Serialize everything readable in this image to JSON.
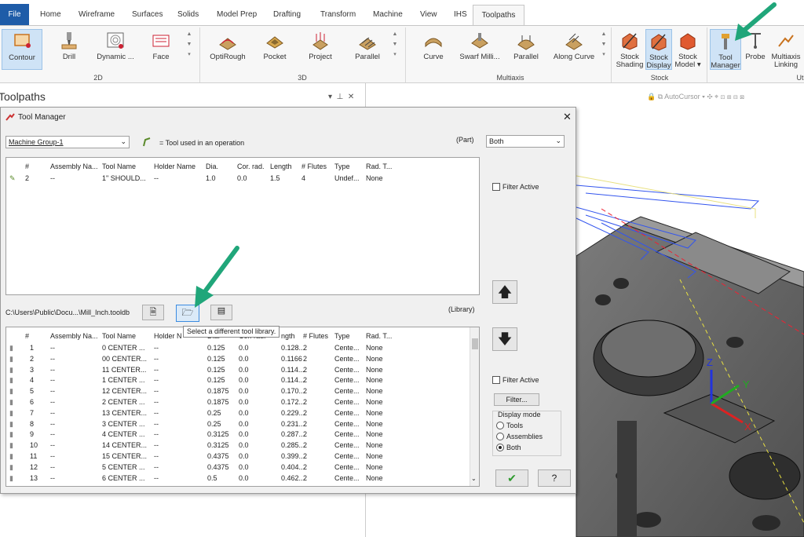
{
  "ribbon": {
    "tabs": [
      "File",
      "Home",
      "Wireframe",
      "Surfaces",
      "Solids",
      "Model Prep",
      "Drafting",
      "Transform",
      "Machine",
      "View",
      "IHS",
      "Toolpaths"
    ],
    "groups": {
      "g2d": "2D",
      "g3d": "3D",
      "multiaxis": "Multiaxis",
      "stock": "Stock",
      "util": "Ut"
    },
    "buttons": {
      "contour": "Contour",
      "drill": "Drill",
      "dynamic": "Dynamic ...",
      "face": "Face",
      "optirough": "OptiRough",
      "pocket": "Pocket",
      "project": "Project",
      "parallel3d": "Parallel",
      "curve": "Curve",
      "swarf": "Swarf Milli...",
      "parallel_ma": "Parallel",
      "along_curve": "Along Curve",
      "stock_shading_1": "Stock",
      "stock_shading_2": "Shading",
      "stock_display_1": "Stock",
      "stock_display_2": "Display",
      "stock_model_1": "Stock",
      "stock_model_2": "Model ▾",
      "tool_manager_1": "Tool",
      "tool_manager_2": "Manager",
      "probe": "Probe",
      "multiaxis_linking_1": "Multiaxis",
      "multiaxis_linking_2": "Linking"
    }
  },
  "toolpaths_pane": {
    "title": "Toolpaths",
    "pin": "⊥ ×"
  },
  "viewport": {
    "autocursor": "AutoCursor"
  },
  "dialog": {
    "title": "Tool Manager",
    "group_select": "Machine Group-1",
    "used_legend": "= Tool used in an operation",
    "part_label": "(Part)",
    "filter_mode": "Both",
    "filter_active_top": "Filter Active",
    "filter_active_bottom": "Filter Active",
    "filter_button": "Filter...",
    "display_mode": "Display mode",
    "radio_tools": "Tools",
    "radio_assemblies": "Assemblies",
    "radio_both": "Both",
    "library_path": "C:\\Users\\Public\\Docu...\\Mill_Inch.tooldb",
    "library_label": "(Library)",
    "tooltip": "Select a different tool library.",
    "columns": [
      "#",
      "Assembly Na...",
      "Tool Name",
      "Holder Name",
      "Dia.",
      "Cor. rad.",
      "Length",
      "# Flutes",
      "Type",
      "Rad. T..."
    ],
    "lib_columns": [
      "#",
      "Assembly Na...",
      "Tool Name",
      "Holder N",
      "Dia.",
      "Cor. rad.",
      "ngth",
      "# Flutes",
      "Type",
      "Rad. T..."
    ],
    "part_rows": [
      [
        "2",
        "--",
        "1\" SHOULD...",
        "--",
        "1.0",
        "0.0",
        "1.5",
        "4",
        "Undef...",
        "None"
      ]
    ],
    "lib_rows": [
      [
        "1",
        "--",
        "0 CENTER ...",
        "--",
        "0.125",
        "0.0",
        "0.128...",
        "2",
        "Cente...",
        "None"
      ],
      [
        "2",
        "--",
        "00 CENTER...",
        "--",
        "0.125",
        "0.0",
        "0.1166",
        "2",
        "Cente...",
        "None"
      ],
      [
        "3",
        "--",
        "11 CENTER...",
        "--",
        "0.125",
        "0.0",
        "0.114...",
        "2",
        "Cente...",
        "None"
      ],
      [
        "4",
        "--",
        "1 CENTER ...",
        "--",
        "0.125",
        "0.0",
        "0.114...",
        "2",
        "Cente...",
        "None"
      ],
      [
        "5",
        "--",
        "12 CENTER...",
        "--",
        "0.1875",
        "0.0",
        "0.170...",
        "2",
        "Cente...",
        "None"
      ],
      [
        "6",
        "--",
        "2 CENTER ...",
        "--",
        "0.1875",
        "0.0",
        "0.172...",
        "2",
        "Cente...",
        "None"
      ],
      [
        "7",
        "--",
        "13 CENTER...",
        "--",
        "0.25",
        "0.0",
        "0.229...",
        "2",
        "Cente...",
        "None"
      ],
      [
        "8",
        "--",
        "3 CENTER ...",
        "--",
        "0.25",
        "0.0",
        "0.231...",
        "2",
        "Cente...",
        "None"
      ],
      [
        "9",
        "--",
        "4 CENTER ...",
        "--",
        "0.3125",
        "0.0",
        "0.287...",
        "2",
        "Cente...",
        "None"
      ],
      [
        "10",
        "--",
        "14 CENTER...",
        "--",
        "0.3125",
        "0.0",
        "0.285...",
        "2",
        "Cente...",
        "None"
      ],
      [
        "11",
        "--",
        "15 CENTER...",
        "--",
        "0.4375",
        "0.0",
        "0.399...",
        "2",
        "Cente...",
        "None"
      ],
      [
        "12",
        "--",
        "5 CENTER ...",
        "--",
        "0.4375",
        "0.0",
        "0.404...",
        "2",
        "Cente...",
        "None"
      ],
      [
        "13",
        "--",
        "6 CENTER ...",
        "--",
        "0.5",
        "0.0",
        "0.462...",
        "2",
        "Cente...",
        "None"
      ]
    ]
  },
  "colors": {
    "accent": "#1e5ca8",
    "arrow": "#20a67a",
    "ok": "#2e9a2e"
  }
}
